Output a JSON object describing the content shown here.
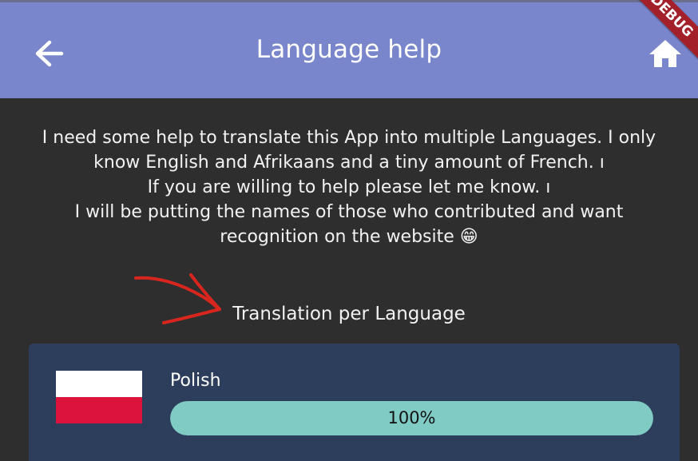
{
  "appbar": {
    "title": "Language help",
    "back_icon": "arrow-left-icon",
    "home_icon": "home-icon"
  },
  "debug_banner": "DEBUG",
  "intro": {
    "lines": [
      "I need some help to translate this App into multiple Languages. I only know English and Afrikaans and a tiny amount of French. ı",
      "If you are willing to help please let me know. ı",
      "I will be putting the names of those who contributed and want recognition on the website 😁"
    ]
  },
  "section_heading": "Translation per Language",
  "languages": [
    {
      "name": "Polish",
      "progress_label": "100%",
      "progress": 1.0
    }
  ],
  "colors": {
    "appbar": "#7986cb",
    "background": "#2e2e2e",
    "card": "#2c3e5c",
    "progress_fill": "#80cbc4",
    "debug_ribbon": "#a3202a",
    "annotation_arrow": "#d8261f"
  }
}
